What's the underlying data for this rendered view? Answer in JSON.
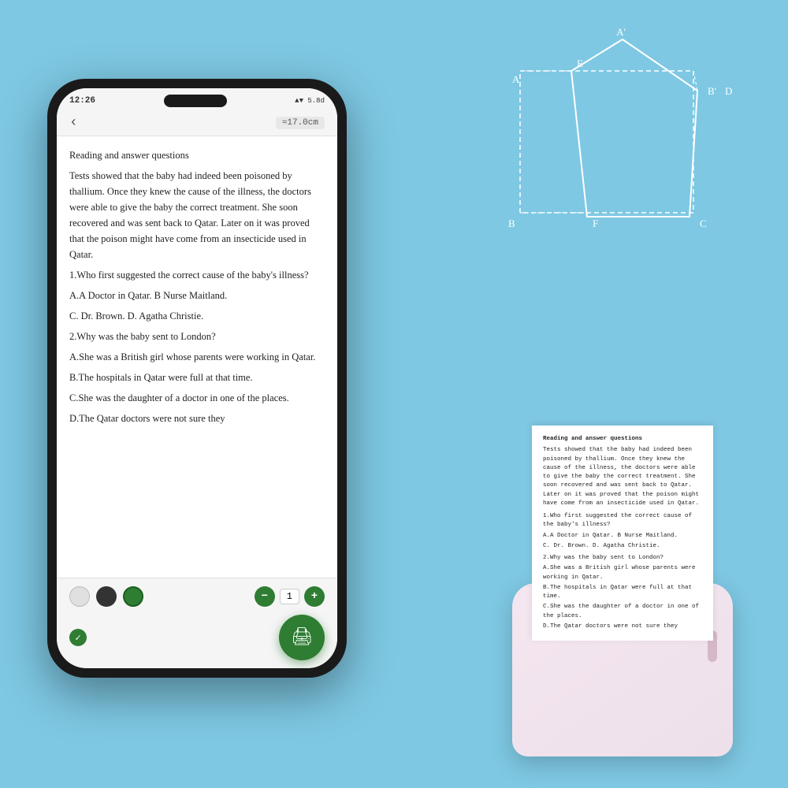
{
  "background_color": "#7ec8e3",
  "phone": {
    "status_time": "12:26",
    "status_signal": "▲▼ 5.8d",
    "battery": "■■■",
    "back_icon": "‹",
    "ruler_label": "≈17.0cm",
    "content_title": "Reading and answer questions",
    "content_passage": "Tests showed that the baby had indeed been poisoned by thallium. Once they knew the cause of the illness, the doctors were able to give the baby the correct treatment. She soon recovered and was sent back to Qatar. Later on it was proved that the poison might have come from an insecticide used in Qatar.",
    "q1": "1.Who first suggested the correct cause of the baby's illness?",
    "q1a": "A.A Doctor in Qatar.    B Nurse Maitland.",
    "q1b": "C. Dr. Brown.    D. Agatha Christie.",
    "q2": "2.Why was the baby sent to London?",
    "q2a": "A.She was a British girl whose parents were working in Qatar.",
    "q2b": "B.The hospitals in Qatar were full at that time.",
    "q2c": "C.She was the daughter of a doctor in one of the places.",
    "q2d": "D.The Qatar doctors were not sure they",
    "print_icon": "🖨",
    "check_icon": "✓",
    "size_value": "1",
    "minus_label": "−",
    "plus_label": "+"
  },
  "printer": {
    "paper_title": "Reading and answer questions",
    "paper_passage": "Tests showed that the baby had indeed been poisoned by thallium. Once they knew the cause of the illness, the doctors were able to give the baby the correct treatment. She soon recovered and was sent back to Qatar. Later on it was proved that the poison might have come from an insecticide used in Qatar.",
    "paper_q1": "1.Who first suggested the correct cause of the baby's illness?",
    "paper_q1a": "A.A Doctor in Qatar.    B Nurse Maitland.",
    "paper_q1b": "C. Dr. Brown.    D. Agatha Christie.",
    "paper_q2": "2.Why was the baby sent to London?",
    "paper_q2a": "A.She was a British girl whose parents were working in Qatar.",
    "paper_q2b": "B.The hospitals in Qatar were full at that time.",
    "paper_q2c": "C.She was the daughter of a doctor in one of the places.",
    "paper_q2d": "D.The Qatar doctors were not sure they"
  },
  "geometry": {
    "label_a_prime": "A'",
    "label_a": "A",
    "label_b_prime": "B'",
    "label_b": "B",
    "label_c": "C",
    "label_d": "D",
    "label_e": "E",
    "label_f": "F"
  }
}
